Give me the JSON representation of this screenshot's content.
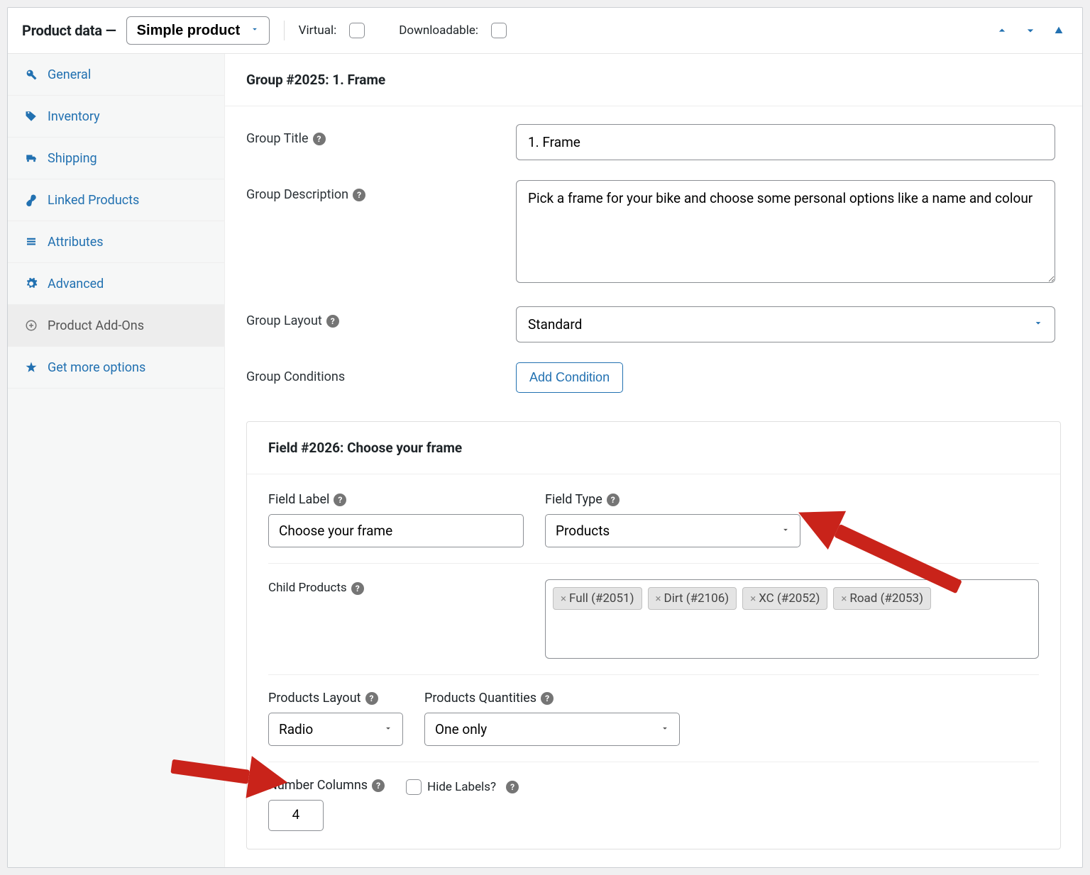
{
  "header": {
    "title": "Product data —",
    "product_type": "Simple product",
    "virtual_label": "Virtual:",
    "downloadable_label": "Downloadable:"
  },
  "sidebar": {
    "items": [
      {
        "label": "General",
        "icon": "wrench-icon"
      },
      {
        "label": "Inventory",
        "icon": "tag-icon"
      },
      {
        "label": "Shipping",
        "icon": "truck-icon"
      },
      {
        "label": "Linked Products",
        "icon": "link-icon"
      },
      {
        "label": "Attributes",
        "icon": "list-icon"
      },
      {
        "label": "Advanced",
        "icon": "gear-icon"
      },
      {
        "label": "Product Add-Ons",
        "icon": "plus-icon"
      },
      {
        "label": "Get more options",
        "icon": "star-icon"
      }
    ],
    "active_index": 6
  },
  "group": {
    "heading": "Group #2025: 1. Frame",
    "labels": {
      "title": "Group Title",
      "description": "Group Description",
      "layout": "Group Layout",
      "conditions": "Group Conditions"
    },
    "values": {
      "title": "1. Frame",
      "description": "Pick a frame for your bike and choose some personal options like a name and colour",
      "layout": "Standard"
    },
    "add_condition": "Add Condition"
  },
  "field": {
    "heading": "Field #2026: Choose your frame",
    "labels": {
      "field_label": "Field Label",
      "field_type": "Field Type",
      "child_products": "Child Products",
      "products_layout": "Products Layout",
      "products_quantities": "Products Quantities",
      "number_columns": "Number Columns",
      "hide_labels": "Hide Labels?"
    },
    "values": {
      "field_label": "Choose your frame",
      "field_type": "Products",
      "products_layout": "Radio",
      "products_quantities": "One only",
      "number_columns": "4"
    },
    "child_products": [
      "Full (#2051)",
      "Dirt (#2106)",
      "XC (#2052)",
      "Road (#2053)"
    ]
  }
}
